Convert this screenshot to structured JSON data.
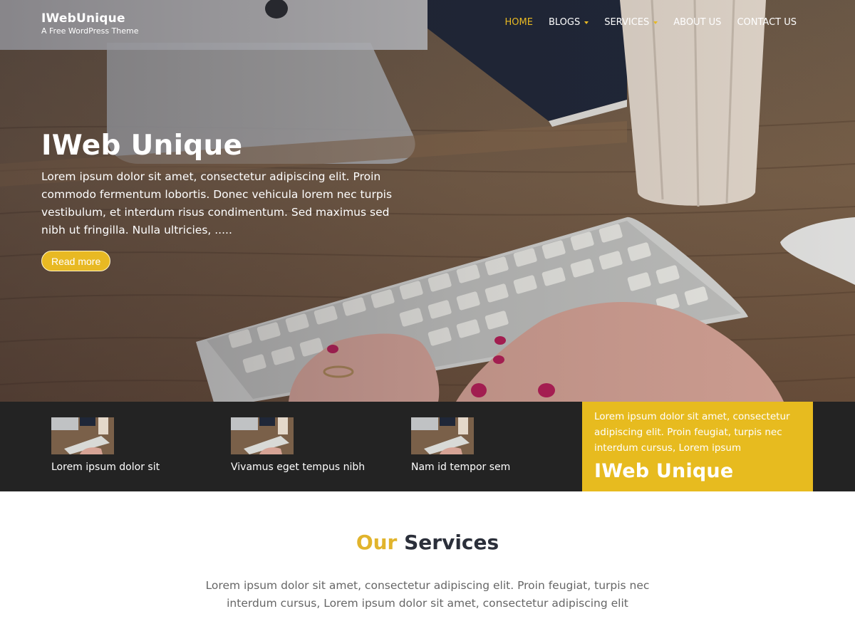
{
  "brand": {
    "name": "IWebUnique",
    "tagline": "A Free WordPress Theme"
  },
  "nav": {
    "items": [
      {
        "label": "HOME"
      },
      {
        "label": "BLOGS"
      },
      {
        "label": "SERVICES"
      },
      {
        "label": "ABOUT US"
      },
      {
        "label": "CONTACT US"
      }
    ]
  },
  "hero": {
    "title": "IWeb Unique",
    "text": "Lorem ipsum dolor sit amet, consectetur adipiscing elit. Proin commodo fermentum lobortis. Donec vehicula lorem nec turpis vestibulum, et interdum risus condimentum. Sed maximus sed nibh ut fringilla. Nulla ultricies, .....",
    "button": "Read more"
  },
  "features": {
    "cards": [
      {
        "label": "Lorem ipsum dolor sit"
      },
      {
        "label": "Vivamus eget tempus nibh"
      },
      {
        "label": "Nam id tempor sem"
      }
    ],
    "highlight": {
      "text": "Lorem ipsum dolor sit amet, consectetur adipiscing elit. Proin feugiat, turpis nec interdum cursus, Lorem ipsum",
      "title": "IWeb Unique"
    }
  },
  "services": {
    "title_accent": "Our",
    "title_rest": "Services",
    "text": "Lorem ipsum dolor sit amet, consectetur adipiscing elit. Proin feugiat, turpis nec interdum cursus, Lorem ipsum dolor sit amet, consectetur adipiscing elit"
  },
  "colors": {
    "accent": "#e8b923",
    "strip_bg": "#232323",
    "highlight_bg": "#e7bb1f",
    "heading_dark": "#2b2f3a"
  },
  "icons": {
    "nav_dropdown": "chevron-down-icon"
  }
}
